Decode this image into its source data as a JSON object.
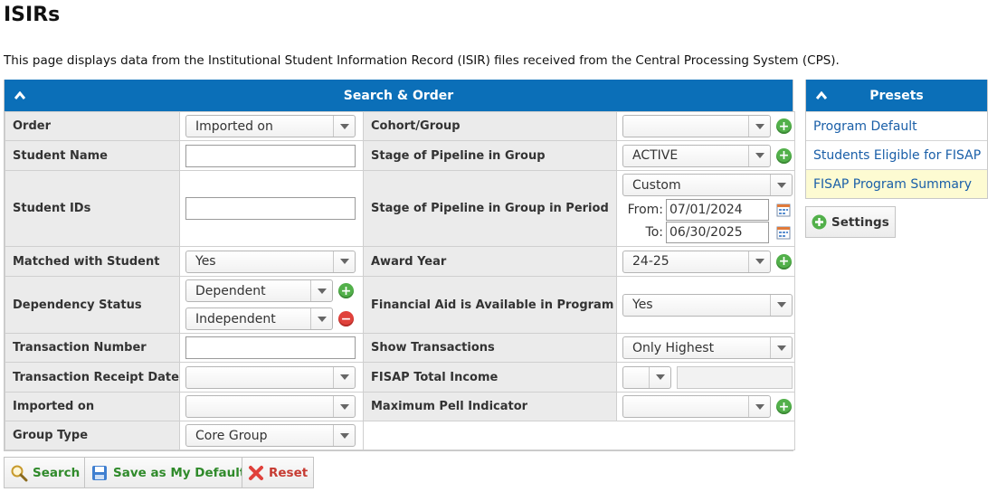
{
  "page": {
    "title": "ISIRs",
    "description": "This page displays data from the Institutional Student Information Record (ISIR) files received from the Central Processing System (CPS)."
  },
  "search_panel": {
    "title": "Search & Order",
    "order": {
      "label": "Order",
      "value": "Imported on"
    },
    "student_name": {
      "label": "Student Name",
      "value": ""
    },
    "student_ids": {
      "label": "Student IDs",
      "value": ""
    },
    "matched_with_student": {
      "label": "Matched with Student",
      "value": "Yes"
    },
    "dependency_status": {
      "label": "Dependency Status",
      "values": [
        "Dependent",
        "Independent"
      ]
    },
    "transaction_number": {
      "label": "Transaction Number",
      "value": ""
    },
    "transaction_receipt_date": {
      "label": "Transaction Receipt Date",
      "value": ""
    },
    "imported_on": {
      "label": "Imported on",
      "value": ""
    },
    "group_type": {
      "label": "Group Type",
      "value": "Core Group"
    },
    "cohort_group": {
      "label": "Cohort/Group",
      "value": ""
    },
    "stage_of_pipeline_in_group": {
      "label": "Stage of Pipeline in Group",
      "value": "ACTIVE"
    },
    "stage_of_pipeline_in_group_in_period": {
      "label": "Stage of Pipeline in Group in Period",
      "value": "Custom",
      "from_label": "From:",
      "from_value": "07/01/2024",
      "to_label": "To:",
      "to_value": "06/30/2025"
    },
    "award_year": {
      "label": "Award Year",
      "value": "24-25"
    },
    "financial_aid_available": {
      "label": "Financial Aid is Available in Program",
      "value": "Yes"
    },
    "show_transactions": {
      "label": "Show Transactions",
      "value": "Only Highest"
    },
    "fisap_total_income": {
      "label": "FISAP Total Income",
      "value": ""
    },
    "maximum_pell_indicator": {
      "label": "Maximum Pell Indicator",
      "value": ""
    }
  },
  "presets": {
    "title": "Presets",
    "items": [
      "Program Default",
      "Students Eligible for FISAP",
      "FISAP Program Summary"
    ],
    "settings_label": "Settings"
  },
  "actions": {
    "search_label": "Search",
    "save_default_label": "Save as My Default",
    "reset_label": "Reset"
  },
  "colors": {
    "header_blue": "#0b6fb8",
    "label_bg": "#ebebeb",
    "link_blue": "#1a5fa8",
    "add_green": "#52b04a",
    "remove_red": "#e0413b",
    "active_preset_bg": "#fdfbd2"
  }
}
